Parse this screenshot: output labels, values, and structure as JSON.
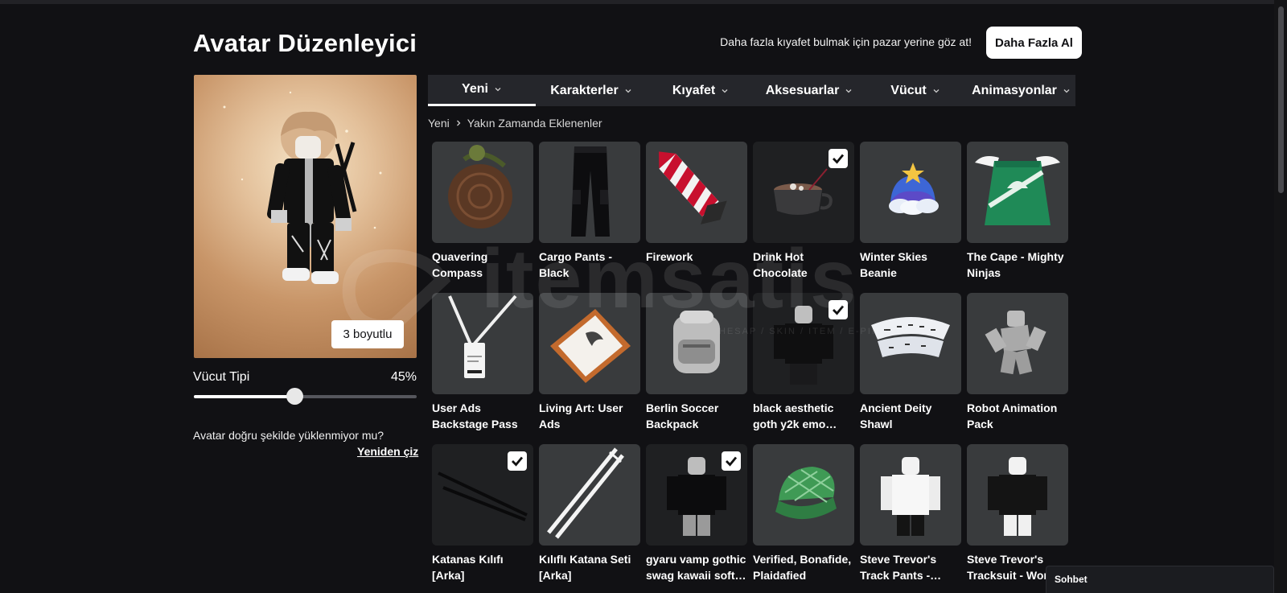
{
  "header": {
    "title": "Avatar Düzenleyici",
    "promo_text": "Daha fazla kıyafet bulmak için pazar yerine göz at!",
    "more_button": "Daha Fazla Al"
  },
  "avatar": {
    "view_button": "3 boyutlu",
    "body_type_label": "Vücut Tipi",
    "body_type_value": "45%",
    "body_type_fraction": 0.45,
    "load_question": "Avatar doğru şekilde yüklenmiyor mu?",
    "redraw_link": "Yeniden çiz"
  },
  "tabs": [
    {
      "label": "Yeni",
      "active": true
    },
    {
      "label": "Karakterler",
      "active": false
    },
    {
      "label": "Kıyafet",
      "active": false
    },
    {
      "label": "Aksesuarlar",
      "active": false
    },
    {
      "label": "Vücut",
      "active": false
    },
    {
      "label": "Animasyonlar",
      "active": false
    }
  ],
  "breadcrumb": {
    "root": "Yeni",
    "current": "Yakın Zamanda Eklenenler"
  },
  "items": [
    {
      "name": "Quavering Compass",
      "selected": false,
      "icon": "compass-icon"
    },
    {
      "name": "Cargo Pants - Black",
      "selected": false,
      "icon": "pants-icon"
    },
    {
      "name": "Firework",
      "selected": false,
      "icon": "firework-icon"
    },
    {
      "name": "Drink Hot Chocolate",
      "selected": true,
      "icon": "mug-icon"
    },
    {
      "name": "Winter Skies Beanie",
      "selected": false,
      "icon": "beanie-icon"
    },
    {
      "name": "The Cape - Mighty Ninjas",
      "selected": false,
      "icon": "cape-icon"
    },
    {
      "name": "User Ads Backstage Pass",
      "selected": false,
      "icon": "badge-icon"
    },
    {
      "name": "Living Art: User Ads",
      "selected": false,
      "icon": "frame-icon"
    },
    {
      "name": "Berlin Soccer Backpack",
      "selected": false,
      "icon": "backpack-icon"
    },
    {
      "name": "black aesthetic goth y2k emo…",
      "selected": true,
      "icon": "shirt-icon"
    },
    {
      "name": "Ancient Deity Shawl",
      "selected": false,
      "icon": "shawl-icon"
    },
    {
      "name": "Robot Animation Pack",
      "selected": false,
      "icon": "robot-icon"
    },
    {
      "name": "Katanas Kılıfı [Arka]",
      "selected": true,
      "icon": "katana-dark-icon"
    },
    {
      "name": "Kılıflı Katana Seti [Arka]",
      "selected": false,
      "icon": "katana-white-icon"
    },
    {
      "name": "gyaru vamp gothic swag kawaii soft…",
      "selected": true,
      "icon": "outfit-icon"
    },
    {
      "name": "Verified, Bonafide, Plaidafied",
      "selected": false,
      "icon": "cap-icon"
    },
    {
      "name": "Steve Trevor's Track Pants -…",
      "selected": false,
      "icon": "figure-white-icon"
    },
    {
      "name": "Steve Trevor's Tracksuit - Wor",
      "selected": false,
      "icon": "figure-black-icon"
    }
  ],
  "watermark": {
    "text": "itemsatis",
    "sub": "HESAP / SKIN / ITEM / E-PIN.COM"
  },
  "chat": {
    "label": "Sohbet"
  },
  "colors": {
    "background": "#111114",
    "tile": "#393b3d",
    "tab_bar": "#25262b"
  }
}
